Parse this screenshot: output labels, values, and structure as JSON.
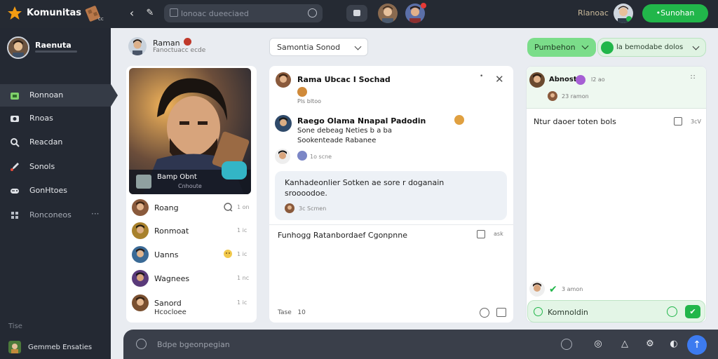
{
  "app": {
    "title": "Komunitas"
  },
  "top": {
    "search_placeholder": "lonoac dueeciaed",
    "brand": "Rlanoac",
    "share_label": "•Sunohan"
  },
  "sidebar": {
    "user_name": "Raenuta",
    "items": [
      {
        "label": "Ronnoan",
        "icon": "home-icon"
      },
      {
        "label": "Rnoas",
        "icon": "camera-icon"
      },
      {
        "label": "Reacdan",
        "icon": "search-icon"
      },
      {
        "label": "Sonols",
        "icon": "rocket-icon"
      },
      {
        "label": "GonHtoes",
        "icon": "gamepad-icon"
      },
      {
        "label": "Ronconeos",
        "icon": "puzzle-icon",
        "extra": "···"
      }
    ],
    "section_label": "Tise",
    "bottom_label": "Gemmeb Ensaties"
  },
  "main_header": {
    "name": "Raman",
    "sub": "Fanoctuacc ecde"
  },
  "status_select": {
    "value": "Samontia Sonod"
  },
  "green_select": {
    "value": "Pumbehon"
  },
  "green_select2": {
    "value": "la bemodabe dolos"
  },
  "hero": {
    "name": "Bamp Obnt",
    "sub": "Cnhoute"
  },
  "friends": [
    {
      "name": "Roang",
      "time": "1 on"
    },
    {
      "name": "Ronmoat",
      "time": "1 ic"
    },
    {
      "name": "Uanns",
      "time": "1 ic"
    },
    {
      "name": "Wagnees",
      "time": "1 nc"
    },
    {
      "name": "Sanord",
      "time": "1 ic",
      "sub": "Hcocloee"
    }
  ],
  "chat": {
    "header_name": "Rama Ubcac I Sochad",
    "header_time": "Pls bltoo",
    "msg2_name": "Raego Olama Nnapal Padodin",
    "msg2_text": "Sone debeag Neties b a ba",
    "msg2_text2": "Sookenteade Rabanee",
    "msg3_time": "1o scne",
    "bubble_line1": "Kanhadeonlier Sotken ae sore r doganain",
    "bubble_line2": "sroooodoe.",
    "bubble_time": "3c Scmen",
    "reply_text": "Funhogg Ratanbordaef Cgonpnne",
    "reply_time": "ask",
    "footer_label": "Tase",
    "footer_count": "10"
  },
  "right": {
    "name": "Abnost",
    "time1": "l2 ao",
    "time2": "23 ramon",
    "post_text": "Ntur daoer toten bols",
    "time3": "3cV",
    "time4": "3 amon",
    "input_value": "Komnoldin"
  },
  "composer": {
    "placeholder": "Bdpe bgeonpegian"
  },
  "colors": {
    "accent_green": "#21b64a",
    "dark_bg": "#252a33",
    "send_blue": "#3d7bf0"
  }
}
